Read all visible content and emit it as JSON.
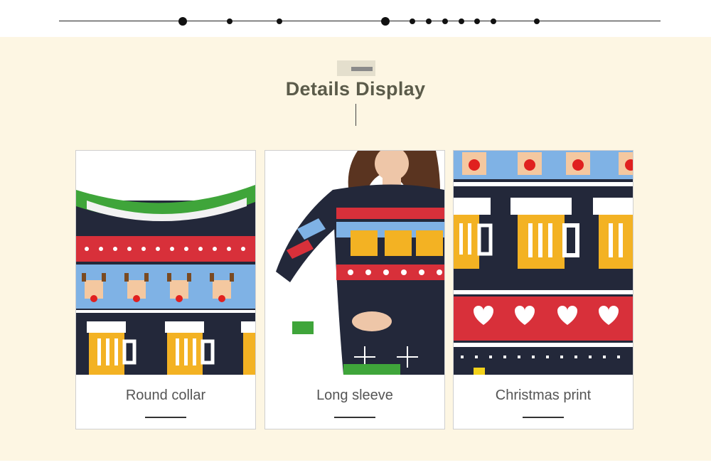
{
  "section_title": "Details Display",
  "cards": [
    {
      "caption": "Round collar",
      "image": "sweater-collar-closeup"
    },
    {
      "caption": "Long sleeve",
      "image": "model-wearing-sweater"
    },
    {
      "caption": "Christmas print",
      "image": "beer-mug-pattern-closeup"
    }
  ],
  "colors": {
    "background": "#fdf6e3",
    "title": "#5b5b4a",
    "sweater_navy": "#23283a",
    "sweater_red": "#d8303a",
    "sweater_blue": "#7fb2e5",
    "sweater_green": "#3fa53a",
    "beer_yellow": "#f3b223"
  }
}
